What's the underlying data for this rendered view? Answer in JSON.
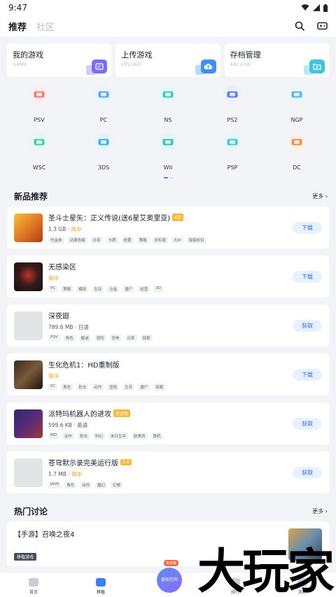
{
  "status": {
    "time": "9:47"
  },
  "header": {
    "tabs": [
      "推荐",
      "社区"
    ]
  },
  "quick": [
    {
      "title": "我的游戏",
      "sub": "GAME",
      "color": "#7b6ef6"
    },
    {
      "title": "上传游戏",
      "sub": "UPLOAD",
      "color": "#3f8ff5"
    },
    {
      "title": "存档管理",
      "sub": "ARCHIVE",
      "color": "#3fc3e0"
    }
  ],
  "platforms": [
    {
      "name": "PSV",
      "color": "#f07a7a",
      "bg": "#fdeeee"
    },
    {
      "name": "PC",
      "color": "#5aa7f0",
      "bg": "#eaf4fd"
    },
    {
      "name": "NS",
      "color": "#3ec7c9",
      "bg": "#e7f8f8"
    },
    {
      "name": "PS2",
      "color": "#5b7cf0",
      "bg": "#eceffd"
    },
    {
      "name": "NGP",
      "color": "#5ab6ea",
      "bg": "#eaf5fc"
    },
    {
      "name": "WSC",
      "color": "#3fcfa0",
      "bg": "#e6f8f1"
    },
    {
      "name": "3DS",
      "color": "#3fb0e8",
      "bg": "#e6f5fc"
    },
    {
      "name": "WII",
      "color": "#36c4b3",
      "bg": "#e5f7f4"
    },
    {
      "name": "PSP",
      "color": "#48c3de",
      "bg": "#e6f6fa"
    },
    {
      "name": "DC",
      "color": "#f08850",
      "bg": "#fdf0e8"
    }
  ],
  "new_section": {
    "title": "新品推荐",
    "more": "更多 ›"
  },
  "games": [
    {
      "name": "圣斗士星矢：正义传说(送6星艾奥里亚)",
      "badge": "4折",
      "meta1": "1.3 GB · ",
      "meta2": "简中",
      "tags": [
        "代金券",
        "动漫改编",
        "日系",
        "卡牌",
        "放置",
        "策略",
        "折扣版",
        "大IP",
        "独家折扣"
      ],
      "action": "下载",
      "thumb": "linear-gradient(135deg,#f6c142,#e07b22,#b33b1c)"
    },
    {
      "name": "无感染区",
      "badge": "",
      "meta1": "",
      "meta2": "简中",
      "tags": [
        "PC",
        "策略",
        "模拟",
        "生存",
        "沙盒",
        "僵尸",
        "经营",
        "3D"
      ],
      "action": "下载",
      "thumb": "radial-gradient(circle at 50% 45%,#c0342b 0,#3a1b1b 45%,#101015 100%)"
    },
    {
      "name": "深夜廻",
      "badge": "",
      "meta1": "789.6 MB · 日语",
      "meta2": "",
      "tags": [
        "PSV",
        "角色",
        "解谜",
        "冒险",
        "恐怖",
        "日系",
        "探索"
      ],
      "action": "获取",
      "thumb": "#e3e4e6"
    },
    {
      "name": "生化危机1：HD重制版",
      "badge": "",
      "meta1": "",
      "meta2": "简中",
      "tags": [
        "PC",
        "角色",
        "射击",
        "动作",
        "冒险",
        "生存",
        "僵尸",
        "探索"
      ],
      "action": "下载",
      "thumb": "linear-gradient(135deg,#3a2a22,#7a5a3a,#1d1410)"
    },
    {
      "name": "派特玛机器人的进攻",
      "badge": "完全版",
      "meta1": "599.6 KB · 英语",
      "meta2": "",
      "tags": [
        "MD",
        "动作",
        "射击",
        "科幻",
        "末日生存",
        "欧美风",
        "联机"
      ],
      "action": "获取",
      "thumb": "linear-gradient(135deg,#2b2b6e,#5a2a7a,#9a3a3a)"
    },
    {
      "name": "苍穹默示录完美运行版",
      "badge": "1.0",
      "meta1": "1.7 MB · ",
      "meta2": "简中",
      "tags": [
        "JAVA",
        "角色",
        "动作",
        "魔幻",
        "幻想"
      ],
      "action": "获取",
      "thumb": "#e3e4e6"
    }
  ],
  "hot_section": {
    "title": "热门讨论",
    "more": "更多 ›"
  },
  "discussion": {
    "title": "【手游】召唤之夜4",
    "tag": "移植游戏"
  },
  "nav": [
    {
      "label": "首页"
    },
    {
      "label": "移植"
    },
    {
      "label": "排行"
    },
    {
      "label": "我的"
    }
  ],
  "center_button": {
    "label": "虚拟空间",
    "badge": "免安装"
  },
  "watermark": "大玩家"
}
